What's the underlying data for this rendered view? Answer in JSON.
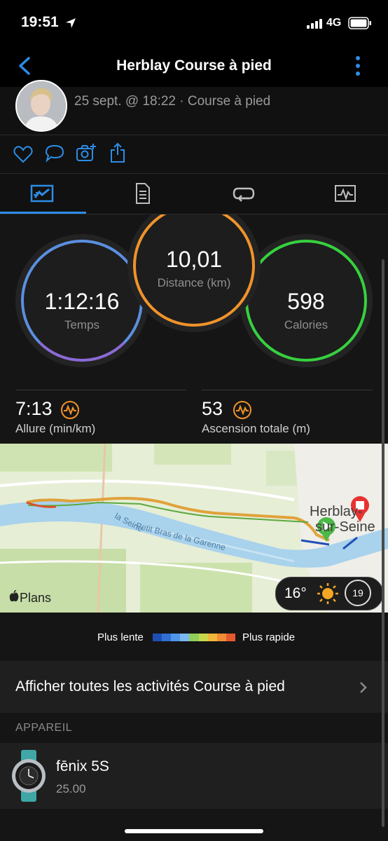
{
  "status_bar": {
    "time": "19:51",
    "network": "4G"
  },
  "header": {
    "title": "Herblay Course à pied"
  },
  "profile": {
    "meta": "25 sept. @ 18:22 · Course à pied"
  },
  "stats": {
    "time": {
      "value": "1:12:16",
      "label": "Temps",
      "color": "#5b8fe0"
    },
    "distance": {
      "value": "10,01",
      "label": "Distance (km)",
      "color": "#f0932b"
    },
    "calories": {
      "value": "598",
      "label": "Calories",
      "color": "#36d13f"
    }
  },
  "metrics": {
    "pace": {
      "value": "7:13",
      "label": "Allure (min/km)"
    },
    "ascent": {
      "value": "53",
      "label": "Ascension totale (m)"
    }
  },
  "map": {
    "river_label_1": "la Seine",
    "river_label_2": "Petit Bras de la Garenne",
    "town_label_1": "Herblay-",
    "town_label_2": "sur-Seine",
    "attribution": "Plans",
    "weather": {
      "temperature": "16°",
      "wind": "19"
    }
  },
  "legend": {
    "slow_label": "Plus lente",
    "fast_label": "Plus rapide",
    "colors": [
      "#1f4fb5",
      "#2f6fd6",
      "#4f95e8",
      "#7bb8f0",
      "#8fcf5a",
      "#c9d84a",
      "#f0b63a",
      "#f08c34",
      "#e45a2e"
    ]
  },
  "activities_link": {
    "label": "Afficher toutes les activités Course à pied"
  },
  "device_section": {
    "title": "APPAREIL",
    "device_name": "fēnix 5S",
    "device_version": "25.00"
  },
  "colors": {
    "accent": "#2d8de6",
    "background": "#151515"
  }
}
